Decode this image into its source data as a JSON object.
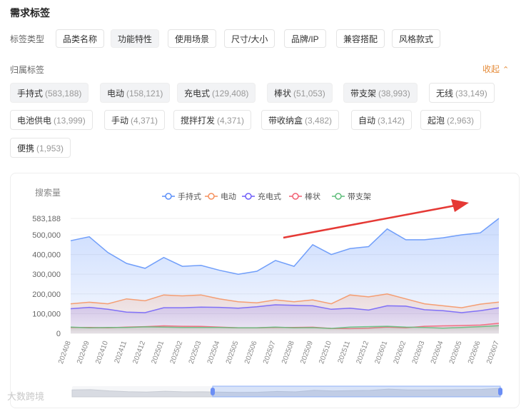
{
  "section_title": "需求标签",
  "tag_type": {
    "label": "标签类型",
    "options": [
      "品类名称",
      "功能特性",
      "使用场景",
      "尺寸/大小",
      "品牌/IP",
      "兼容搭配",
      "风格款式"
    ],
    "active_index": 1
  },
  "belong": {
    "label": "归属标签",
    "collapse_label": "收起",
    "tags": [
      {
        "name": "手持式",
        "count": "(583,188)"
      },
      {
        "name": "电动",
        "count": "(158,121)"
      },
      {
        "name": "充电式",
        "count": "(129,408)"
      },
      {
        "name": "棒状",
        "count": "(51,053)"
      },
      {
        "name": "带支架",
        "count": "(38,993)"
      },
      {
        "name": "无线",
        "count": "(33,149)"
      },
      {
        "name": "电池供电",
        "count": "(13,999)"
      },
      {
        "name": "手动",
        "count": "(4,371)"
      },
      {
        "name": "搅拌打发",
        "count": "(4,371)"
      },
      {
        "name": "带收纳盒",
        "count": "(3,482)"
      },
      {
        "name": "自动",
        "count": "(3,142)"
      },
      {
        "name": "起泡",
        "count": "(2,963)"
      },
      {
        "name": "便携",
        "count": "(1,953)"
      }
    ],
    "selected_indices": [
      0,
      1,
      2,
      3,
      4
    ]
  },
  "watermark": "大数跨境",
  "chart_data": {
    "type": "area",
    "ylabel": "搜索量",
    "yticks": [
      "0",
      "100,000",
      "200,000",
      "300,000",
      "400,000",
      "500,000",
      "583,188"
    ],
    "ylim": [
      0,
      583188
    ],
    "legend_position": "top",
    "grid": true,
    "x": [
      "202408",
      "202409",
      "202410",
      "202411",
      "202412",
      "202501",
      "202502",
      "202503",
      "202504",
      "202505",
      "202506",
      "202507",
      "202508",
      "202509",
      "202510",
      "202511",
      "202512",
      "202601",
      "202602",
      "202603",
      "202604",
      "202605",
      "202606",
      "202607"
    ],
    "series": [
      {
        "name": "手持式",
        "color": "#5b8ff9",
        "values": [
          470000,
          490000,
          410000,
          355000,
          330000,
          385000,
          340000,
          345000,
          320000,
          300000,
          315000,
          370000,
          340000,
          450000,
          400000,
          430000,
          440000,
          530000,
          475000,
          475000,
          485000,
          500000,
          510000,
          583188
        ]
      },
      {
        "name": "电动",
        "color": "#f6905d",
        "values": [
          150000,
          158000,
          150000,
          175000,
          165000,
          195000,
          190000,
          195000,
          175000,
          160000,
          155000,
          170000,
          160000,
          170000,
          150000,
          195000,
          185000,
          200000,
          175000,
          150000,
          140000,
          130000,
          148000,
          158121
        ]
      },
      {
        "name": "充电式",
        "color": "#6f5ef9",
        "values": [
          125000,
          132000,
          122000,
          108000,
          105000,
          130000,
          130000,
          133000,
          132000,
          128000,
          135000,
          145000,
          142000,
          140000,
          122000,
          128000,
          118000,
          140000,
          138000,
          120000,
          115000,
          105000,
          115000,
          129408
        ]
      },
      {
        "name": "棒状",
        "color": "#f25f72",
        "values": [
          30000,
          30000,
          28000,
          32000,
          34000,
          38000,
          36000,
          35000,
          32000,
          28000,
          28000,
          30000,
          30000,
          31000,
          25000,
          24000,
          26000,
          32000,
          28000,
          36000,
          38000,
          40000,
          42000,
          51053
        ]
      },
      {
        "name": "带支架",
        "color": "#5ebd7a",
        "values": [
          32000,
          28000,
          30000,
          30000,
          33000,
          32000,
          30000,
          30000,
          30000,
          28000,
          28000,
          32000,
          28000,
          29000,
          25000,
          32000,
          34000,
          36000,
          32000,
          30000,
          26000,
          30000,
          34000,
          38993
        ]
      }
    ]
  }
}
